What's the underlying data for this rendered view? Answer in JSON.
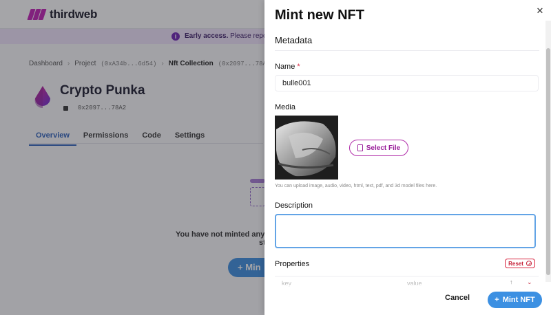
{
  "app": {
    "logo_text": "thirdweb",
    "banner": {
      "bold": "Early access.",
      "text": " Please repo"
    },
    "breadcrumb": {
      "dashboard": "Dashboard",
      "project": "Project",
      "project_addr": "(0xA34b...6d54)",
      "collection": "Nft Collection",
      "collection_addr": "(0x2097...78A"
    },
    "collection": {
      "title": "Crypto Punka",
      "address": "0x2097...78A2"
    },
    "tabs": [
      {
        "label": "Overview"
      },
      {
        "label": "Permissions"
      },
      {
        "label": "Code"
      },
      {
        "label": "Settings"
      }
    ],
    "empty_state": {
      "line1": "You have not minted any NI",
      "line2": "st"
    },
    "bg_mint_label": "+ Min"
  },
  "drawer": {
    "title": "Mint new NFT",
    "section": "Metadata",
    "name": {
      "label": "Name",
      "required_mark": "*",
      "value": "bulle001"
    },
    "media": {
      "label": "Media",
      "select_label": "Select File",
      "hint": "You can upload image, audio, video, html, text, pdf, and 3d model files here."
    },
    "description": {
      "label": "Description",
      "value": ""
    },
    "properties": {
      "label": "Properties",
      "reset_label": "Reset",
      "key_placeholder": "key",
      "value_placeholder": "value"
    },
    "footer": {
      "cancel_label": "Cancel",
      "mint_label": "Mint NFT",
      "mint_prefix": "+"
    },
    "close_symbol": "✕"
  },
  "colors": {
    "accent": "#3c90e2",
    "brand": "#c21cb5",
    "danger": "#d8203b"
  }
}
